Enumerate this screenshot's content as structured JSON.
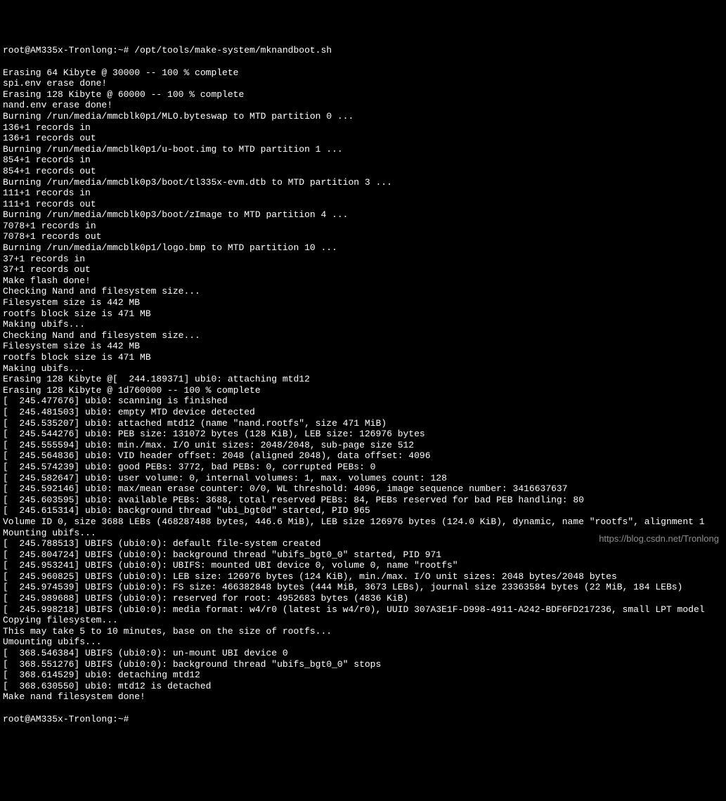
{
  "terminal": {
    "prompt1": "root@AM335x-Tronlong:~# /opt/tools/make-system/mknandboot.sh",
    "lines": [
      "Erasing 64 Kibyte @ 30000 -- 100 % complete",
      "spi.env erase done!",
      "Erasing 128 Kibyte @ 60000 -- 100 % complete",
      "nand.env erase done!",
      "Burning /run/media/mmcblk0p1/MLO.byteswap to MTD partition 0 ...",
      "136+1 records in",
      "136+1 records out",
      "Burning /run/media/mmcblk0p1/u-boot.img to MTD partition 1 ...",
      "854+1 records in",
      "854+1 records out",
      "Burning /run/media/mmcblk0p3/boot/tl335x-evm.dtb to MTD partition 3 ...",
      "111+1 records in",
      "111+1 records out",
      "Burning /run/media/mmcblk0p3/boot/zImage to MTD partition 4 ...",
      "7078+1 records in",
      "7078+1 records out",
      "Burning /run/media/mmcblk0p1/logo.bmp to MTD partition 10 ...",
      "37+1 records in",
      "37+1 records out",
      "Make flash done!",
      "Checking Nand and filesystem size...",
      "Filesystem size is 442 MB",
      "rootfs block size is 471 MB",
      "Making ubifs...",
      "Checking Nand and filesystem size...",
      "Filesystem size is 442 MB",
      "rootfs block size is 471 MB",
      "Making ubifs...",
      "Erasing 128 Kibyte @[  244.189371] ubi0: attaching mtd12",
      "Erasing 128 Kibyte @ 1d760000 -- 100 % complete",
      "[  245.477676] ubi0: scanning is finished",
      "[  245.481503] ubi0: empty MTD device detected",
      "[  245.535207] ubi0: attached mtd12 (name \"nand.rootfs\", size 471 MiB)",
      "[  245.544276] ubi0: PEB size: 131072 bytes (128 KiB), LEB size: 126976 bytes",
      "[  245.555594] ubi0: min./max. I/O unit sizes: 2048/2048, sub-page size 512",
      "[  245.564836] ubi0: VID header offset: 2048 (aligned 2048), data offset: 4096",
      "[  245.574239] ubi0: good PEBs: 3772, bad PEBs: 0, corrupted PEBs: 0",
      "[  245.582647] ubi0: user volume: 0, internal volumes: 1, max. volumes count: 128",
      "[  245.592146] ubi0: max/mean erase counter: 0/0, WL threshold: 4096, image sequence number: 3416637637",
      "[  245.603595] ubi0: available PEBs: 3688, total reserved PEBs: 84, PEBs reserved for bad PEB handling: 80",
      "[  245.615314] ubi0: background thread \"ubi_bgt0d\" started, PID 965",
      "Volume ID 0, size 3688 LEBs (468287488 bytes, 446.6 MiB), LEB size 126976 bytes (124.0 KiB), dynamic, name \"rootfs\", alignment 1",
      "Mounting ubifs...",
      "[  245.788513] UBIFS (ubi0:0): default file-system created",
      "[  245.804724] UBIFS (ubi0:0): background thread \"ubifs_bgt0_0\" started, PID 971",
      "[  245.953241] UBIFS (ubi0:0): UBIFS: mounted UBI device 0, volume 0, name \"rootfs\"",
      "[  245.960825] UBIFS (ubi0:0): LEB size: 126976 bytes (124 KiB), min./max. I/O unit sizes: 2048 bytes/2048 bytes",
      "[  245.974539] UBIFS (ubi0:0): FS size: 466382848 bytes (444 MiB, 3673 LEBs), journal size 23363584 bytes (22 MiB, 184 LEBs)",
      "[  245.989688] UBIFS (ubi0:0): reserved for root: 4952683 bytes (4836 KiB)",
      "[  245.998218] UBIFS (ubi0:0): media format: w4/r0 (latest is w4/r0), UUID 307A3E1F-D998-4911-A242-BDF6FD217236, small LPT model",
      "Copying filesystem...",
      "This may take 5 to 10 minutes, base on the size of rootfs...",
      "Umounting ubifs...",
      "[  368.546384] UBIFS (ubi0:0): un-mount UBI device 0",
      "[  368.551276] UBIFS (ubi0:0): background thread \"ubifs_bgt0_0\" stops",
      "[  368.614529] ubi0: detaching mtd12",
      "[  368.630550] ubi0: mtd12 is detached",
      "Make nand filesystem done!"
    ],
    "prompt2": "root@AM335x-Tronlong:~#"
  },
  "watermark": "https://blog.csdn.net/Tronlong"
}
